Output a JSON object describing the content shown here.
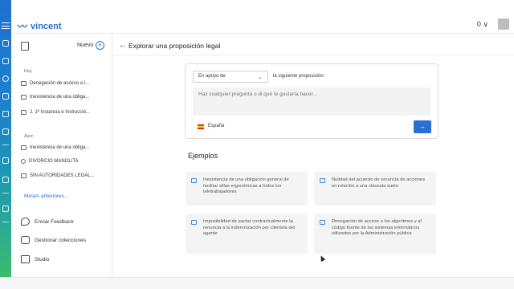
{
  "app": {
    "brand": "vincent",
    "count": "0",
    "colors": {
      "accent": "#2a6fd6",
      "rail_top": "#1f6fd1",
      "rail_bottom": "#3dbb6d"
    }
  },
  "sidebar": {
    "new_label": "Nuevo",
    "groups": [
      {
        "label": "Hoy",
        "items": [
          {
            "icon": "chat-icon",
            "label": "Denegación de acceso a l..."
          },
          {
            "icon": "chat-icon",
            "label": "Inexistencia de una obliga..."
          },
          {
            "icon": "folder-icon",
            "label": "J. 1ª Instancia e Instrucció..."
          }
        ]
      },
      {
        "label": "Ayer",
        "items": [
          {
            "icon": "chat-icon",
            "label": "Inexistencia de una obliga..."
          },
          {
            "icon": "search-icon",
            "label": "DIVORCIO MANOLITA"
          },
          {
            "icon": "chat-icon",
            "label": "SIN AUTORIDADES LEGAL..."
          }
        ]
      }
    ],
    "more_label": "Meses anteriores...",
    "footer": [
      {
        "icon": "feedback-icon",
        "label": "Enviar Feedback"
      },
      {
        "icon": "collections-icon",
        "label": "Gestionar colecciones"
      },
      {
        "icon": "cube-icon",
        "label": "Studio"
      }
    ]
  },
  "main": {
    "title": "Explorar una proposición legal",
    "select_value": "En apoyo de",
    "after_select": "la siguiente proposición:",
    "query_placeholder": "Haz cualquier pregunta o di qué te gustaría hacer...",
    "country": "España",
    "examples_title": "Ejemplos",
    "examples": [
      "Inexistencia de una obligación general de facilitar sillas ergonómicas a todos los teletrabajadores",
      "Nulidad del acuerdo de renuncia de acciones en relación a una cláusula suelo",
      "Imposibilidad de pactar contractualmente la renuncia a la indemnización por clientela del agente",
      "Denegación de acceso a los algoritmos y al código fuente de los sistemas informáticos utilizados por la Administración pública"
    ]
  }
}
